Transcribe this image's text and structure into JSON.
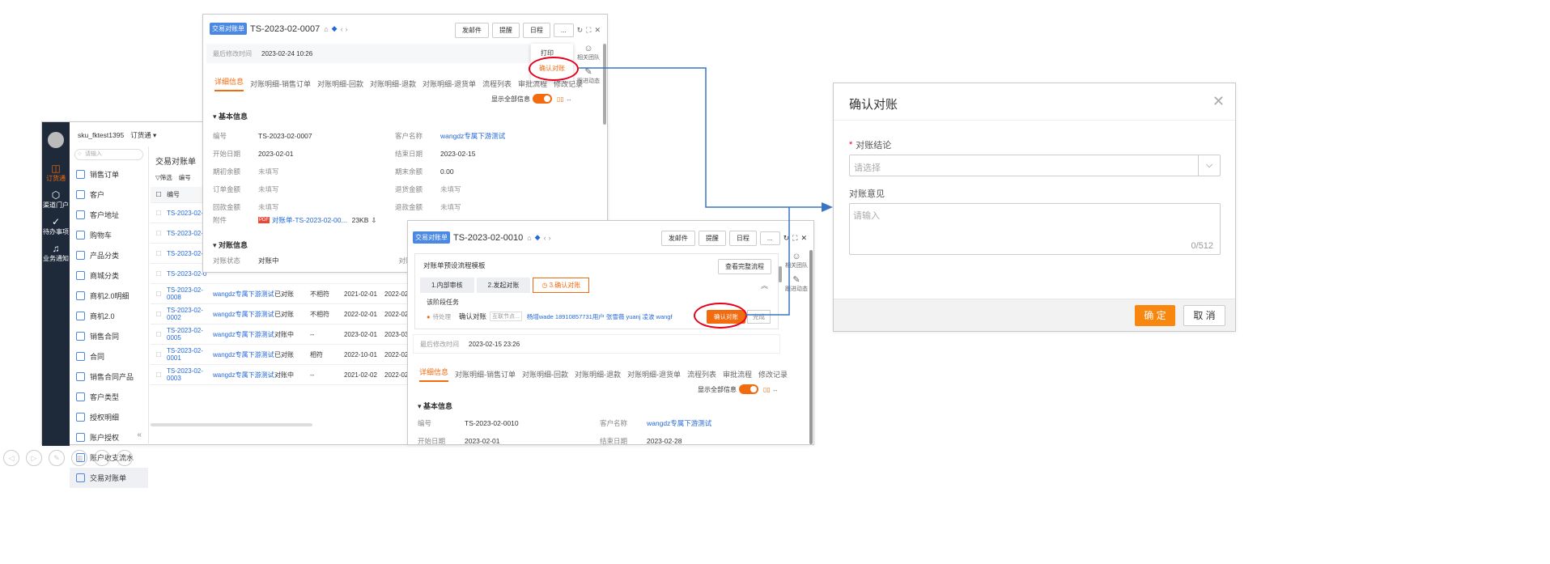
{
  "left_app": {
    "user": "sku_fktest1395",
    "app_switch": "订货通 ▾",
    "search_placeholder": "请输入",
    "nav": [
      {
        "icon": "order-icon",
        "label": "订货通"
      },
      {
        "icon": "cube-icon",
        "label": "渠道门户"
      },
      {
        "icon": "check-icon",
        "label": "待办事项"
      },
      {
        "icon": "bell-icon",
        "label": "业务通知"
      }
    ],
    "menu": [
      "销售订单",
      "客户",
      "客户地址",
      "购物车",
      "产品分类",
      "商城分类",
      "商机2.0明细",
      "商机2.0",
      "销售合同",
      "合同",
      "销售合同产品",
      "客户类型",
      "授权明细",
      "账户授权",
      "账户收支流水",
      "交易对账单"
    ],
    "list_title": "交易对账单",
    "filter_label": "筛选",
    "col_label": "编号",
    "collapse": "«",
    "rows": [
      {
        "no": "TS-2023-02-0",
        "cust": "",
        "status": "",
        "match": "",
        "d1": "",
        "d2": ""
      },
      {
        "no": "TS-2023-02-0",
        "cust": "",
        "status": "",
        "match": "",
        "d1": "",
        "d2": ""
      },
      {
        "no": "TS-2023-02-0",
        "cust": "",
        "status": "",
        "match": "",
        "d1": "",
        "d2": ""
      },
      {
        "no": "TS-2023-02-0",
        "cust": "",
        "status": "",
        "match": "",
        "d1": "",
        "d2": ""
      },
      {
        "no": "TS-2023-02-0008",
        "cust": "wangdz专属下游测试",
        "status": "已对账",
        "match": "不相符",
        "d1": "2021-02-01",
        "d2": "2022-02"
      },
      {
        "no": "TS-2023-02-0002",
        "cust": "wangdz专属下游测试",
        "status": "已对账",
        "match": "不相符",
        "d1": "2022-02-01",
        "d2": "2022-02"
      },
      {
        "no": "TS-2023-02-0005",
        "cust": "wangdz专属下游测试",
        "status": "对账中",
        "match": "--",
        "d1": "2023-02-01",
        "d2": "2023-03"
      },
      {
        "no": "TS-2023-02-0001",
        "cust": "wangdz专属下游测试",
        "status": "已对账",
        "match": "相符",
        "d1": "2022-10-01",
        "d2": "2022-02"
      },
      {
        "no": "TS-2023-02-0003",
        "cust": "wangdz专属下游测试",
        "status": "对账中",
        "match": "--",
        "d1": "2021-02-02",
        "d2": "2022-02"
      }
    ]
  },
  "detail1": {
    "tag": "交易对账单",
    "title": "TS-2023-02-0007",
    "buttons": [
      "发邮件",
      "提醒",
      "日程",
      "..."
    ],
    "last_modified_label": "最后修改时间",
    "last_modified": "2023-02-24 10:26",
    "tabs": [
      "详细信息",
      "对账明细-销售订单",
      "对账明细-回款",
      "对账明细-退款",
      "对账明细-退货单",
      "流程列表",
      "审批流程",
      "修改记录"
    ],
    "show_all": "显示全部信息",
    "section_basic": "基本信息",
    "fields_left": [
      {
        "k": "编号",
        "v": "TS-2023-02-0007"
      },
      {
        "k": "开始日期",
        "v": "2023-02-01"
      },
      {
        "k": "期初余额",
        "v": "未填写"
      },
      {
        "k": "订单金额",
        "v": "未填写"
      },
      {
        "k": "回款金额",
        "v": "未填写"
      }
    ],
    "fields_right": [
      {
        "k": "客户名称",
        "v": "wangdz专属下游测试"
      },
      {
        "k": "结束日期",
        "v": "2023-02-15"
      },
      {
        "k": "期末余额",
        "v": "0.00"
      },
      {
        "k": "退货金额",
        "v": "未填写"
      },
      {
        "k": "退款金额",
        "v": "未填写"
      }
    ],
    "attach_label": "附件",
    "attach_name": "对账单-TS-2023-02-00...",
    "attach_size": "23KB",
    "section_recon": "对账信息",
    "recon_status_label": "对账状态",
    "recon_status": "对账中",
    "recon_extra": "对账",
    "dropdown": [
      "打印",
      "确认对账"
    ],
    "side": [
      "相关团队",
      "跟进动态"
    ]
  },
  "detail2": {
    "tag": "交易对账单",
    "title": "TS-2023-02-0010",
    "buttons": [
      "发邮件",
      "提醒",
      "日程",
      "..."
    ],
    "flow_title": "对账单预设流程模板",
    "flow_btn": "查看完整流程",
    "steps": [
      "1.内部审核",
      "2.发起对账",
      "3.确认对账"
    ],
    "stage_task": "该阶段任务",
    "pending": "待处理",
    "task_name": "确认对账",
    "task_node": "互联节点...",
    "assignees": "杨增wade  18910857731用户  张雪薇  yuanj  凌波  wangf",
    "confirm_btn": "确认对账",
    "done_btn": "完成",
    "last_modified_label": "最后修改时间",
    "last_modified": "2023-02-15 23:26",
    "tabs": [
      "详细信息",
      "对账明细-销售订单",
      "对账明细-回款",
      "对账明细-退款",
      "对账明细-退货单",
      "流程列表",
      "审批流程",
      "修改记录"
    ],
    "show_all": "显示全部信息",
    "section_basic": "基本信息",
    "f1k": "编号",
    "f1v": "TS-2023-02-0010",
    "f2k": "客户名称",
    "f2v": "wangdz专属下游测试",
    "f3k": "开始日期",
    "f3v": "2023-02-01",
    "f4k": "结束日期",
    "f4v": "2023-02-28",
    "side": [
      "相关团队",
      "跟进动态"
    ]
  },
  "dialog": {
    "title": "确认对账",
    "conclusion_label": "对账结论",
    "select_placeholder": "请选择",
    "opinion_label": "对账意见",
    "opinion_placeholder": "请输入",
    "counter": "0/512",
    "ok": "确 定",
    "cancel": "取 消"
  },
  "colors": {
    "accent": "#f26b0f",
    "link": "#2468d8",
    "nav": "#1e2a3a",
    "arrow": "#3a74c4",
    "ring": "#e8001c"
  }
}
